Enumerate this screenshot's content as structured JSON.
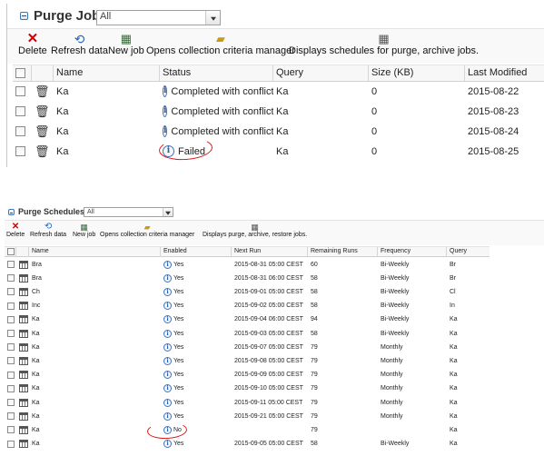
{
  "top": {
    "title": "Purge Jobs",
    "filter_value": "All",
    "toolbar": {
      "delete": "Delete",
      "refresh": "Refresh data",
      "new_job": "New job",
      "criteria": "Opens collection criteria manager",
      "schedules": "Displays schedules for purge, archive jobs."
    },
    "columns": [
      "Name",
      "Status",
      "Query",
      "Size (KB)",
      "Last Modified"
    ],
    "rows": [
      {
        "name": "Ka",
        "status": "Completed with conflict",
        "query": "Ka",
        "size": "0",
        "modified": "2015-08-22"
      },
      {
        "name": "Ka",
        "status": "Completed with conflict",
        "query": "Ka",
        "size": "0",
        "modified": "2015-08-23"
      },
      {
        "name": "Ka",
        "status": "Completed with conflict",
        "query": "Ka",
        "size": "0",
        "modified": "2015-08-24"
      },
      {
        "name": "Ka",
        "status": "Failed",
        "query": "Ka",
        "size": "0",
        "modified": "2015-08-25"
      }
    ]
  },
  "bottom": {
    "title": "Purge Schedules",
    "filter_value": "All",
    "toolbar": {
      "delete": "Delete",
      "refresh": "Refresh data",
      "new_job": "New job",
      "criteria": "Opens collection criteria manager",
      "displays": "Displays purge, archive, restore jobs."
    },
    "columns": [
      "Name",
      "Enabled",
      "Next Run",
      "Remaining Runs",
      "Frequency",
      "Query"
    ],
    "rows": [
      {
        "name": "Bra",
        "enabled": "Yes",
        "next_run": "2015-08-31 05:00 CEST",
        "remaining": "60",
        "frequency": "Bi-Weekly",
        "query": "Br"
      },
      {
        "name": "Bra",
        "enabled": "Yes",
        "next_run": "2015-08-31 06:00 CEST",
        "remaining": "58",
        "frequency": "Bi-Weekly",
        "query": "Br"
      },
      {
        "name": "Ch",
        "enabled": "Yes",
        "next_run": "2015-09-01 05:00 CEST",
        "remaining": "58",
        "frequency": "Bi-Weekly",
        "query": "Cl"
      },
      {
        "name": "Inc",
        "enabled": "Yes",
        "next_run": "2015-09-02 05:00 CEST",
        "remaining": "58",
        "frequency": "Bi-Weekly",
        "query": "In"
      },
      {
        "name": "Ka",
        "enabled": "Yes",
        "next_run": "2015-09-04 06:00 CEST",
        "remaining": "94",
        "frequency": "Bi-Weekly",
        "query": "Ka"
      },
      {
        "name": "Ka",
        "enabled": "Yes",
        "next_run": "2015-09-03 05:00 CEST",
        "remaining": "58",
        "frequency": "Bi-Weekly",
        "query": "Ka"
      },
      {
        "name": "Ka",
        "enabled": "Yes",
        "next_run": "2015-09-07 05:00 CEST",
        "remaining": "79",
        "frequency": "Monthly",
        "query": "Ka"
      },
      {
        "name": "Ka",
        "enabled": "Yes",
        "next_run": "2015-09-08 05:00 CEST",
        "remaining": "79",
        "frequency": "Monthly",
        "query": "Ka"
      },
      {
        "name": "Ka",
        "enabled": "Yes",
        "next_run": "2015-09-09 05:00 CEST",
        "remaining": "79",
        "frequency": "Monthly",
        "query": "Ka"
      },
      {
        "name": "Ka",
        "enabled": "Yes",
        "next_run": "2015-09-10 05:00 CEST",
        "remaining": "79",
        "frequency": "Monthly",
        "query": "Ka"
      },
      {
        "name": "Ka",
        "enabled": "Yes",
        "next_run": "2015-09-11 05:00 CEST",
        "remaining": "79",
        "frequency": "Monthly",
        "query": "Ka"
      },
      {
        "name": "Ka",
        "enabled": "Yes",
        "next_run": "2015-09-21 05:00 CEST",
        "remaining": "79",
        "frequency": "Monthly",
        "query": "Ka"
      },
      {
        "name": "Ka",
        "enabled": "No",
        "next_run": "",
        "remaining": "79",
        "frequency": "",
        "query": "Ka"
      },
      {
        "name": "Ka",
        "enabled": "Yes",
        "next_run": "2015-09-05 05:00 CEST",
        "remaining": "58",
        "frequency": "Bi-Weekly",
        "query": "Ka"
      }
    ]
  },
  "colors": {
    "accent": "#1f4f86",
    "annotation": "#dd1111",
    "header_bg": "#f7f7f7"
  }
}
